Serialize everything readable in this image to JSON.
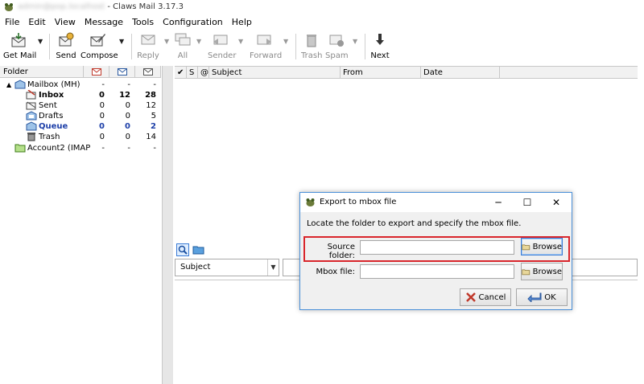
{
  "window": {
    "account_blurred": "admin@pop.localhost",
    "title_suffix": " - Claws Mail 3.17.3"
  },
  "menu": [
    "File",
    "Edit",
    "View",
    "Message",
    "Tools",
    "Configuration",
    "Help"
  ],
  "toolbar": {
    "get_mail": "Get Mail",
    "send": "Send",
    "compose": "Compose",
    "reply": "Reply",
    "all": "All",
    "sender": "Sender",
    "forward": "Forward",
    "trash": "Trash",
    "spam": "Spam",
    "next": "Next"
  },
  "folder_pane": {
    "header": "Folder",
    "rows": [
      {
        "name": "Mailbox (MH)",
        "c1": "-",
        "c2": "-",
        "c3": "-"
      },
      {
        "name": "Inbox",
        "c1": "0",
        "c2": "12",
        "c3": "28"
      },
      {
        "name": "Sent",
        "c1": "0",
        "c2": "0",
        "c3": "12"
      },
      {
        "name": "Drafts",
        "c1": "0",
        "c2": "0",
        "c3": "5"
      },
      {
        "name": "Queue",
        "c1": "0",
        "c2": "0",
        "c3": "2"
      },
      {
        "name": "Trash",
        "c1": "0",
        "c2": "0",
        "c3": "14"
      },
      {
        "name": "Account2 (IMAP",
        "c1": "-",
        "c2": "-",
        "c3": "-"
      }
    ]
  },
  "message_list": {
    "columns": {
      "check": "✔",
      "status": "S",
      "attach": "@",
      "subject": "Subject",
      "from": "From",
      "date": "Date"
    }
  },
  "search": {
    "type": "Subject"
  },
  "dialog": {
    "title": "Export to mbox file",
    "description": "Locate the folder to export and specify the mbox file.",
    "source_label": "Source folder:",
    "mbox_label": "Mbox file:",
    "browse": "Browse",
    "cancel": "Cancel",
    "ok": "OK"
  },
  "colors": {
    "highlight": "#d9262c",
    "accent": "#4a90d9",
    "queue_text": "#1d3fa8"
  }
}
